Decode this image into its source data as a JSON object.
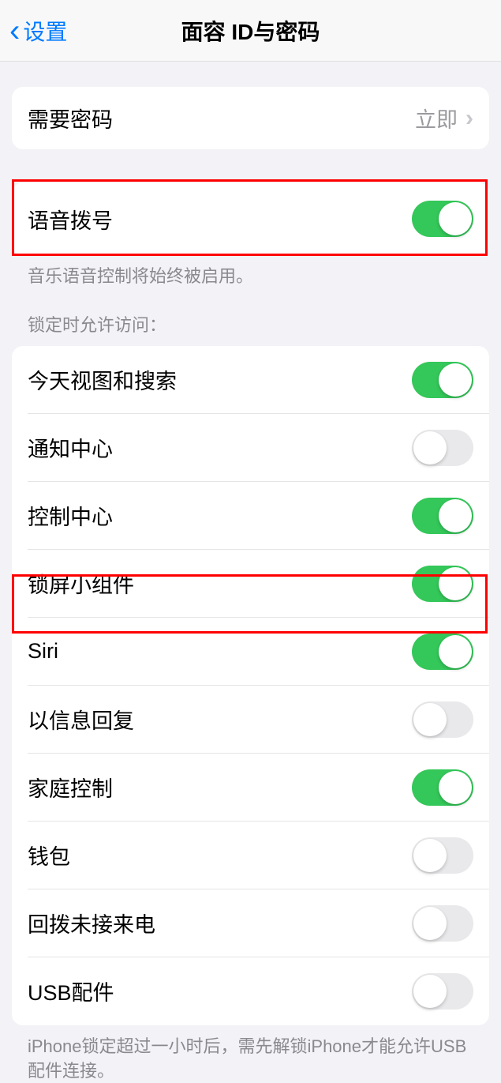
{
  "header": {
    "back_label": "设置",
    "title": "面容 ID与密码"
  },
  "passcode": {
    "label": "需要密码",
    "value": "立即"
  },
  "voice_dial": {
    "label": "语音拨号",
    "footer": "音乐语音控制将始终被启用。",
    "on": true
  },
  "allow_access": {
    "header": "锁定时允许访问：",
    "items": [
      {
        "label": "今天视图和搜索",
        "on": true
      },
      {
        "label": "通知中心",
        "on": false
      },
      {
        "label": "控制中心",
        "on": true
      },
      {
        "label": "锁屏小组件",
        "on": true
      },
      {
        "label": "Siri",
        "on": true
      },
      {
        "label": "以信息回复",
        "on": false
      },
      {
        "label": "家庭控制",
        "on": true
      },
      {
        "label": "钱包",
        "on": false
      },
      {
        "label": "回拨未接来电",
        "on": false
      },
      {
        "label": "USB配件",
        "on": false
      }
    ],
    "footer": "iPhone锁定超过一小时后，需先解锁iPhone才能允许USB配件连接。"
  }
}
